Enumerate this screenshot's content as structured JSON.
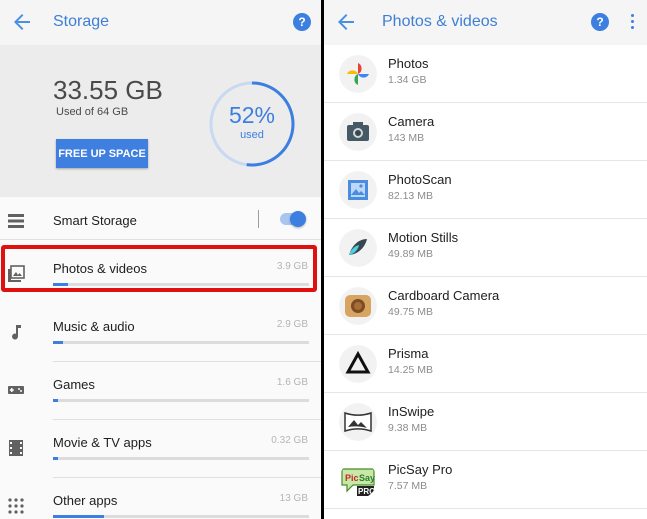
{
  "left": {
    "title": "Storage",
    "used_amount": "33.55 GB",
    "used_of": "Used of 64 GB",
    "free_button": "FREE UP SPACE",
    "percent_label": "52%",
    "percent_used_word": "used",
    "percent_value": 52,
    "smart_storage_label": "Smart Storage",
    "smart_storage_on": true,
    "categories": [
      {
        "label": "Photos & videos",
        "size": "3.9 GB",
        "fraction": 0.06,
        "icon": "photo-icon"
      },
      {
        "label": "Music & audio",
        "size": "2.9 GB",
        "fraction": 0.04,
        "icon": "music-note-icon"
      },
      {
        "label": "Games",
        "size": "1.6 GB",
        "fraction": 0.02,
        "icon": "gamepad-icon"
      },
      {
        "label": "Movie & TV apps",
        "size": "0.32 GB",
        "fraction": 0.02,
        "icon": "film-icon"
      },
      {
        "label": "Other apps",
        "size": "13 GB",
        "fraction": 0.2,
        "icon": "apps-grid-icon"
      }
    ]
  },
  "right": {
    "title": "Photos & videos",
    "apps": [
      {
        "name": "Photos",
        "size": "1.34 GB",
        "icon": "google-photos-icon"
      },
      {
        "name": "Camera",
        "size": "143 MB",
        "icon": "camera-icon"
      },
      {
        "name": "PhotoScan",
        "size": "82.13 MB",
        "icon": "photoscan-icon"
      },
      {
        "name": "Motion Stills",
        "size": "49.89 MB",
        "icon": "motion-stills-icon"
      },
      {
        "name": "Cardboard Camera",
        "size": "49.75 MB",
        "icon": "cardboard-camera-icon"
      },
      {
        "name": "Prisma",
        "size": "14.25 MB",
        "icon": "prisma-icon"
      },
      {
        "name": "InSwipe",
        "size": "9.38 MB",
        "icon": "inswipe-icon"
      },
      {
        "name": "PicSay Pro",
        "size": "7.57 MB",
        "icon": "picsay-pro-icon"
      }
    ]
  },
  "colors": {
    "accent": "#3c7fe0",
    "highlight": "#e01010"
  }
}
